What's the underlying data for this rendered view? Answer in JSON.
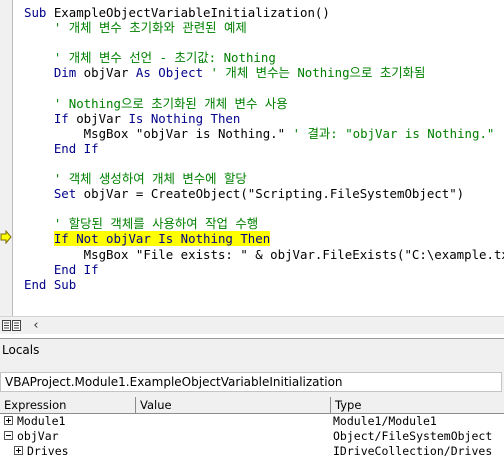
{
  "editor": {
    "lines": [
      [
        {
          "t": "Sub ",
          "c": "kw"
        },
        {
          "t": "ExampleObjectVariableInitialization()",
          "c": ""
        }
      ],
      [
        {
          "t": "    ' 개체 변수 초기화와 관련된 예제",
          "c": "cm"
        }
      ],
      [],
      [
        {
          "t": "    ' 개체 변수 선언 - 초기값: Nothing",
          "c": "cm"
        }
      ],
      [
        {
          "t": "    Dim",
          "c": "kw"
        },
        {
          "t": " objVar ",
          "c": ""
        },
        {
          "t": "As Object",
          "c": "kw"
        },
        {
          "t": " ' 개체 변수는 Nothing으로 초기화됨",
          "c": "cm"
        }
      ],
      [],
      [
        {
          "t": "    ' Nothing으로 초기화된 개체 변수 사용",
          "c": "cm"
        }
      ],
      [
        {
          "t": "    If",
          "c": "kw"
        },
        {
          "t": " objVar ",
          "c": ""
        },
        {
          "t": "Is Nothing Then",
          "c": "kw"
        }
      ],
      [
        {
          "t": "        MsgBox \"objVar is Nothing.\" ",
          "c": ""
        },
        {
          "t": "' 결과: \"objVar is Nothing.\"",
          "c": "cm"
        }
      ],
      [
        {
          "t": "    End If",
          "c": "kw"
        }
      ],
      [],
      [
        {
          "t": "    ' 객체 생성하여 개체 변수에 할당",
          "c": "cm"
        }
      ],
      [
        {
          "t": "    Set",
          "c": "kw"
        },
        {
          "t": " objVar = CreateObject(\"Scripting.FileSystemObject\")",
          "c": ""
        }
      ],
      [],
      [
        {
          "t": "    ' 할당된 객체를 사용하여 작업 수행",
          "c": "cm"
        }
      ],
      [
        {
          "t": "    ",
          "c": ""
        },
        {
          "t": "If Not objVar Is Nothing Then",
          "c": "kw hl"
        }
      ],
      [
        {
          "t": "        MsgBox \"File exists: \" & objVar.FileExists(\"C:\\example.txt\")",
          "c": ""
        }
      ],
      [
        {
          "t": "    End If",
          "c": "kw"
        }
      ],
      [
        {
          "t": "End Sub",
          "c": "kw"
        }
      ]
    ],
    "current_line_color": "#ffff00"
  },
  "locals": {
    "title": "Locals",
    "procedure": "VBAProject.Module1.ExampleObjectVariableInitialization",
    "columns": {
      "expression": "Expression",
      "value": "Value",
      "type": "Type"
    },
    "rows": [
      {
        "expression": "Module1",
        "value": "",
        "type": "Module1/Module1",
        "expander": "plus",
        "indent": 0
      },
      {
        "expression": "objVar",
        "value": "",
        "type": "Object/FileSystemObject",
        "expander": "minus",
        "indent": 0
      },
      {
        "expression": "Drives",
        "value": "",
        "type": "IDriveCollection/Drives",
        "expander": "plus",
        "indent": 1
      }
    ]
  },
  "icons": {
    "breakpoint_arrow": "current-line-arrow-icon",
    "procedure_view": "procedure-view-icon",
    "full_module_view": "full-module-view-icon",
    "scroll_left": "scroll-left-icon"
  }
}
